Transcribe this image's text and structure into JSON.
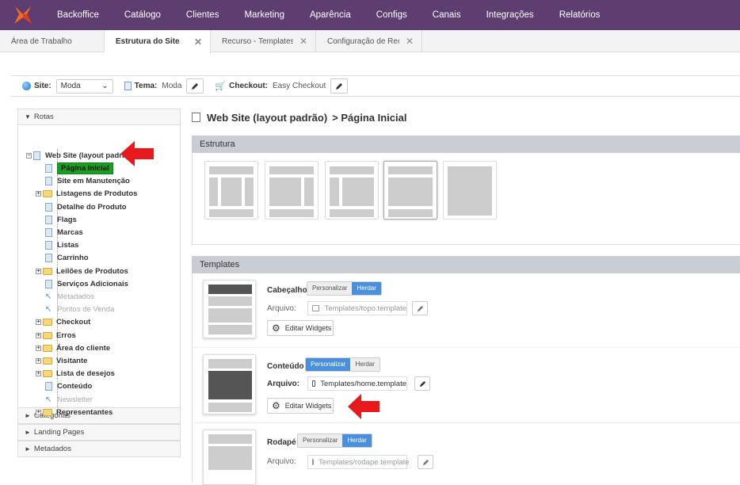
{
  "topbar": {
    "brand": "Backoffice",
    "menu": [
      "Catálogo",
      "Clientes",
      "Marketing",
      "Aparência",
      "Configs",
      "Canais",
      "Integrações",
      "Relatórios"
    ]
  },
  "tabs": [
    {
      "label": "Área de Trabalho",
      "closable": false,
      "active": false
    },
    {
      "label": "Estrutura do Site",
      "closable": true,
      "active": true
    },
    {
      "label": "Recurso - Templates/hom",
      "closable": true,
      "active": false
    },
    {
      "label": "Configuração de Recurso",
      "closable": true,
      "active": false
    }
  ],
  "toolbar": {
    "site_label": "Site:",
    "site_value": "Moda",
    "tema_label": "Tema:",
    "tema_value": "Moda",
    "checkout_label": "Checkout:",
    "checkout_value": "Easy Checkout"
  },
  "sidebar": {
    "rotas_label": "Rotas",
    "root": "Web Site (layout padrão)",
    "items": [
      {
        "label": "Página Inicial",
        "type": "doc",
        "selected": true
      },
      {
        "label": "Site em Manutenção",
        "type": "doc"
      },
      {
        "label": "Listagens de Produtos",
        "type": "folder"
      },
      {
        "label": "Detalhe do Produto",
        "type": "doc"
      },
      {
        "label": "Flags",
        "type": "doc"
      },
      {
        "label": "Marcas",
        "type": "doc"
      },
      {
        "label": "Listas",
        "type": "doc"
      },
      {
        "label": "Carrinho",
        "type": "doc"
      },
      {
        "label": "Leilões de Produtos",
        "type": "folder"
      },
      {
        "label": "Serviços Adicionais",
        "type": "doc"
      },
      {
        "label": "Metadados",
        "type": "disabled"
      },
      {
        "label": "Pontos de Venda",
        "type": "disabled"
      },
      {
        "label": "Checkout",
        "type": "folder"
      },
      {
        "label": "Erros",
        "type": "folder"
      },
      {
        "label": "Área do cliente",
        "type": "folder"
      },
      {
        "label": "Visitante",
        "type": "folder"
      },
      {
        "label": "Lista de desejos",
        "type": "folder"
      },
      {
        "label": "Conteúdo",
        "type": "doc"
      },
      {
        "label": "Newsletter",
        "type": "disabled"
      },
      {
        "label": "Representantes",
        "type": "folder"
      }
    ],
    "sections": [
      "Categorias",
      "Landing Pages",
      "Metadados"
    ]
  },
  "main": {
    "title": "Web Site (layout padrão)",
    "title_suffix": "> Página Inicial",
    "estrutura_label": "Estrutura",
    "templates_label": "Templates",
    "personalizar": "Personalizar",
    "herdar": "Herdar",
    "arquivo_label": "Arquivo:",
    "editar_widgets": "Editar Widgets",
    "templates": [
      {
        "name": "Cabeçalho",
        "file": "Templates/topo.template",
        "mode": "Herdar"
      },
      {
        "name": "Conteúdo",
        "file": "Templates/home.template",
        "mode": "Personalizar"
      },
      {
        "name": "Rodapé",
        "file": "Templates/rodape.template",
        "mode": "Herdar"
      }
    ]
  },
  "colors": {
    "topbar": "#5e3d71",
    "accent": "#4a8fdc",
    "selected_node": "#1a9f1a",
    "arrow": "#e8191d"
  }
}
